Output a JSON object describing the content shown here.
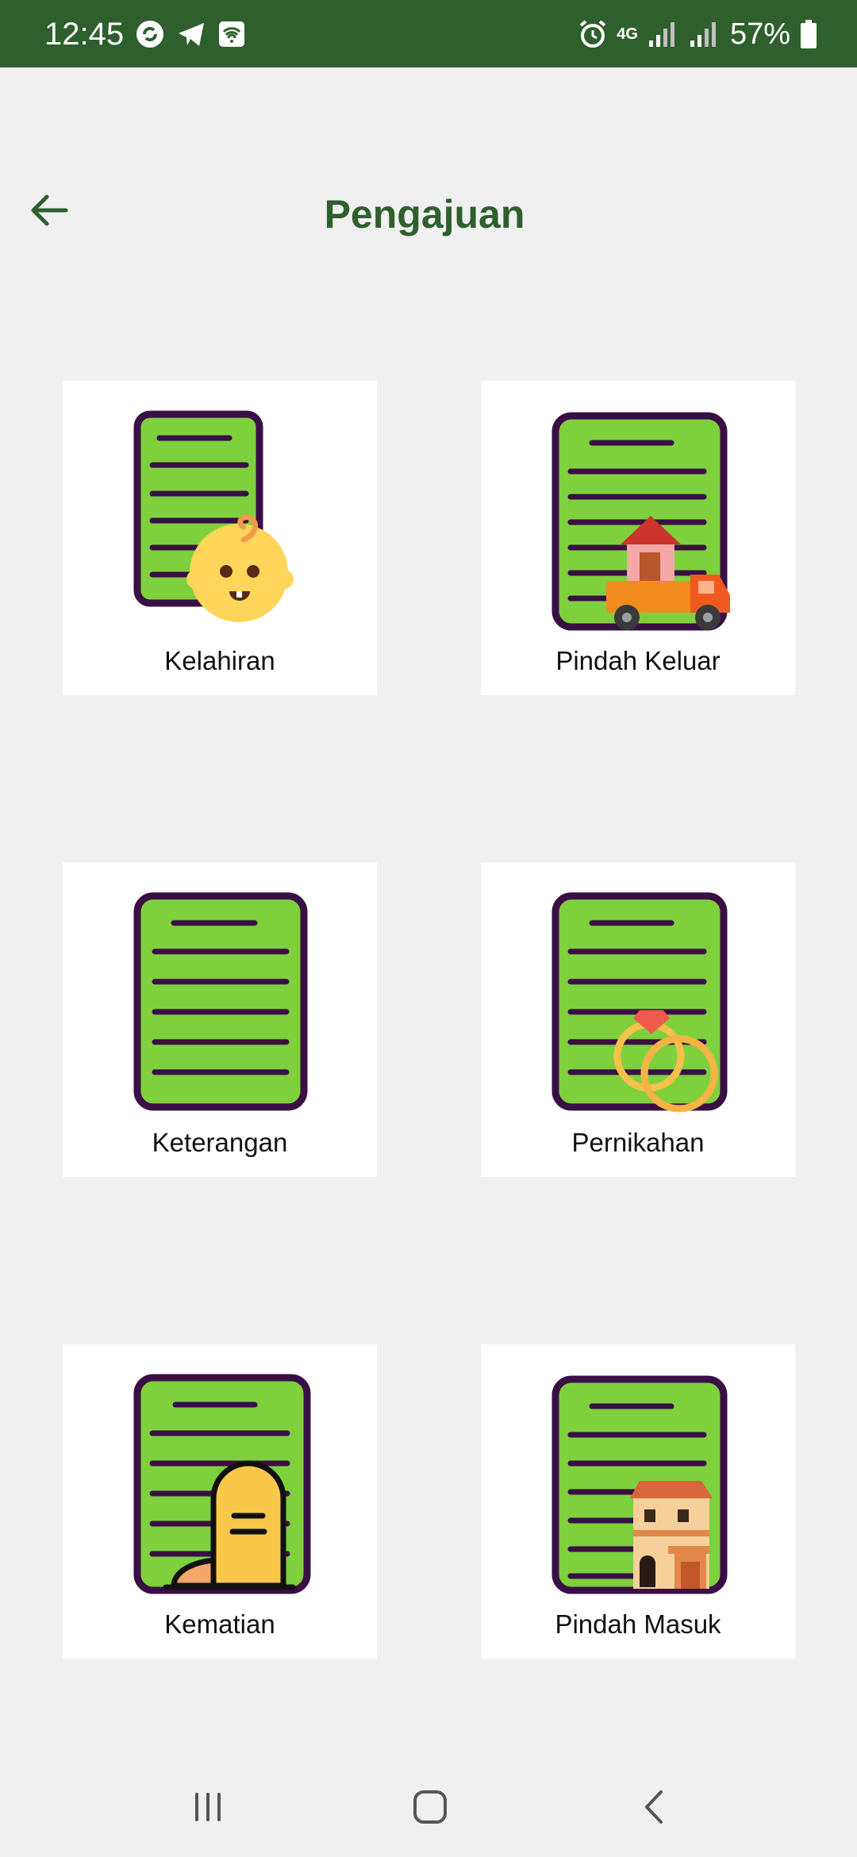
{
  "status_bar": {
    "time": "12:45",
    "battery": "57%",
    "network": "4G",
    "left_icons": [
      "sync-icon",
      "telegram-icon",
      "wifi-icon"
    ],
    "right_icons": [
      "alarm-icon",
      "signal-4g-icon",
      "signal-icon",
      "signal-icon",
      "battery-icon"
    ]
  },
  "header": {
    "title": "Pengajuan",
    "back_icon": "arrow-left-icon"
  },
  "menu": {
    "items": [
      {
        "label": "Kelahiran",
        "icon": "baby-icon"
      },
      {
        "label": "Pindah Keluar",
        "icon": "moving-truck-icon"
      },
      {
        "label": "Keterangan",
        "icon": "document-icon"
      },
      {
        "label": "Pernikahan",
        "icon": "wedding-rings-icon"
      },
      {
        "label": "Kematian",
        "icon": "tombstone-icon"
      },
      {
        "label": "Pindah Masuk",
        "icon": "house-icon"
      }
    ]
  },
  "nav_bar": {
    "buttons": [
      "recent-apps-icon",
      "home-icon",
      "back-icon"
    ]
  },
  "colors": {
    "status_bar": "#2e5f2d",
    "title": "#2e5f2d",
    "document_green": "#7ed03d",
    "document_outline": "#3a0f45",
    "background": "#f0f0f0",
    "card": "#ffffff"
  }
}
